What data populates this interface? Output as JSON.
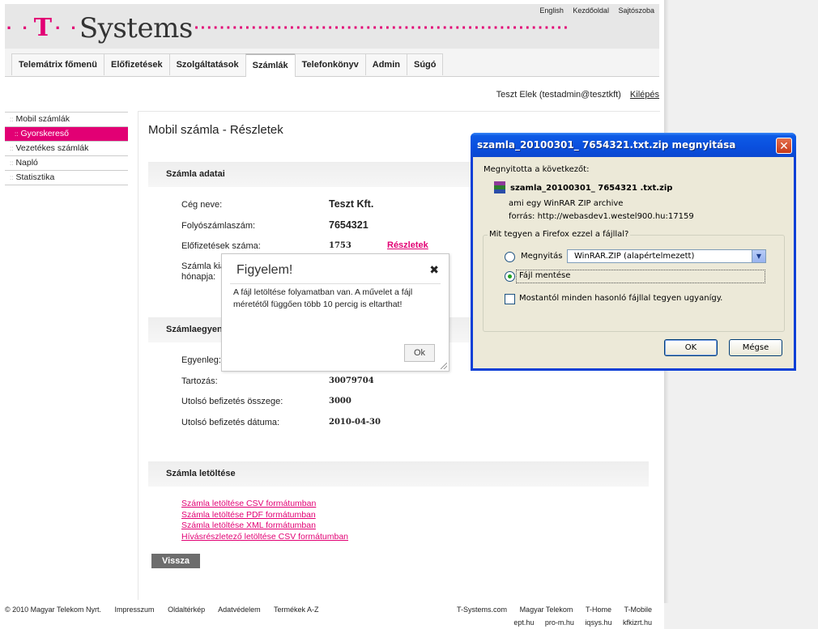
{
  "header": {
    "top_links": [
      "English",
      "Kezdőoldal",
      "Sajtószoba"
    ],
    "logo_dots_left": "· · T · ·",
    "logo_t": "T",
    "logo_text": "Systems",
    "brand_color": "#e20074"
  },
  "nav": {
    "tabs": [
      "Telemátrix főmenü",
      "Előfizetések",
      "Szolgáltatások",
      "Számlák",
      "Telefonkönyv",
      "Admin",
      "Súgó"
    ],
    "active": "Számlák"
  },
  "user": {
    "name": "Teszt Elek (testadmin@tesztkft)",
    "logout": "Kilépés"
  },
  "sidebar": {
    "items": [
      "Mobil számlák",
      "Gyorskereső",
      "Vezetékes számlák",
      "Napló",
      "Statisztika"
    ],
    "active": "Gyorskereső"
  },
  "main": {
    "title": "Mobil számla - Részletek",
    "section1": {
      "title": "Számla adatai",
      "company_label": "Cég neve:",
      "company_value": "Teszt Kft.",
      "account_label": "Folyószámlaszám:",
      "account_value": "7654321",
      "subs_label": "Előfizetések száma:",
      "subs_value": "1753",
      "details_link": "Részletek",
      "issue_label_1": "Számla kiá",
      "issue_label_2": "hónapja:"
    },
    "section2": {
      "title": "Számlaegyen",
      "balance_label": "Egyenleg:",
      "debt_label": "Tartozás:",
      "debt_value": "30079704",
      "last_amount_label": "Utolsó befizetés összege:",
      "last_amount_value": "3000",
      "last_date_label": "Utolsó befizetés dátuma:",
      "last_date_value": "2010-04-30"
    },
    "section3": {
      "title": "Számla letöltése",
      "links": [
        "Számla letöltése CSV formátumban",
        "Számla letöltése PDF formátumban",
        "Számla letöltése XML formátumban",
        "Hívásrészletező letöltése CSV formátumban"
      ]
    },
    "back_button": "Vissza"
  },
  "footer": {
    "left_links": [
      "© 2010 Magyar Telekom Nyrt.",
      "Impresszum",
      "Oldaltérkép",
      "Adatvédelem",
      "Termékek A-Z"
    ],
    "right_links_1": [
      "T-Systems.com",
      "Magyar Telekom",
      "T-Home",
      "T-Mobile"
    ],
    "right_links_2": [
      "ept.hu",
      "pro-m.hu",
      "iqsys.hu",
      "kfkizrt.hu"
    ]
  },
  "warning_dialog": {
    "title": "Figyelem!",
    "message": "A fájl letöltése folyamatban van. A művelet a fájl méretétől függően több 10 percig is eltarthat!",
    "ok_label": "Ok"
  },
  "download_dialog": {
    "title": "szamla_20100301_ 7654321.txt.zip megnyitása",
    "opened_label": "Megnyitotta a következőt:",
    "file_name": "szamla_20100301_ 7654321 .txt.zip",
    "type_line": "ami egy  WinRAR ZIP archive",
    "source_line": "forrás:  http://webasdev1.westel900.hu:17159",
    "group_legend": "Mit tegyen a Firefox ezzel a fájllal?",
    "open_with_label": "Megnyitás",
    "open_with_value": "WinRAR.ZIP (alapértelmezett)",
    "save_label": "Fájl mentése",
    "remember_label": "Mostantól minden hasonló fájllal tegyen ugyanígy.",
    "selected_option": "save",
    "remember_checked": false,
    "ok_label": "OK",
    "cancel_label": "Mégse"
  }
}
